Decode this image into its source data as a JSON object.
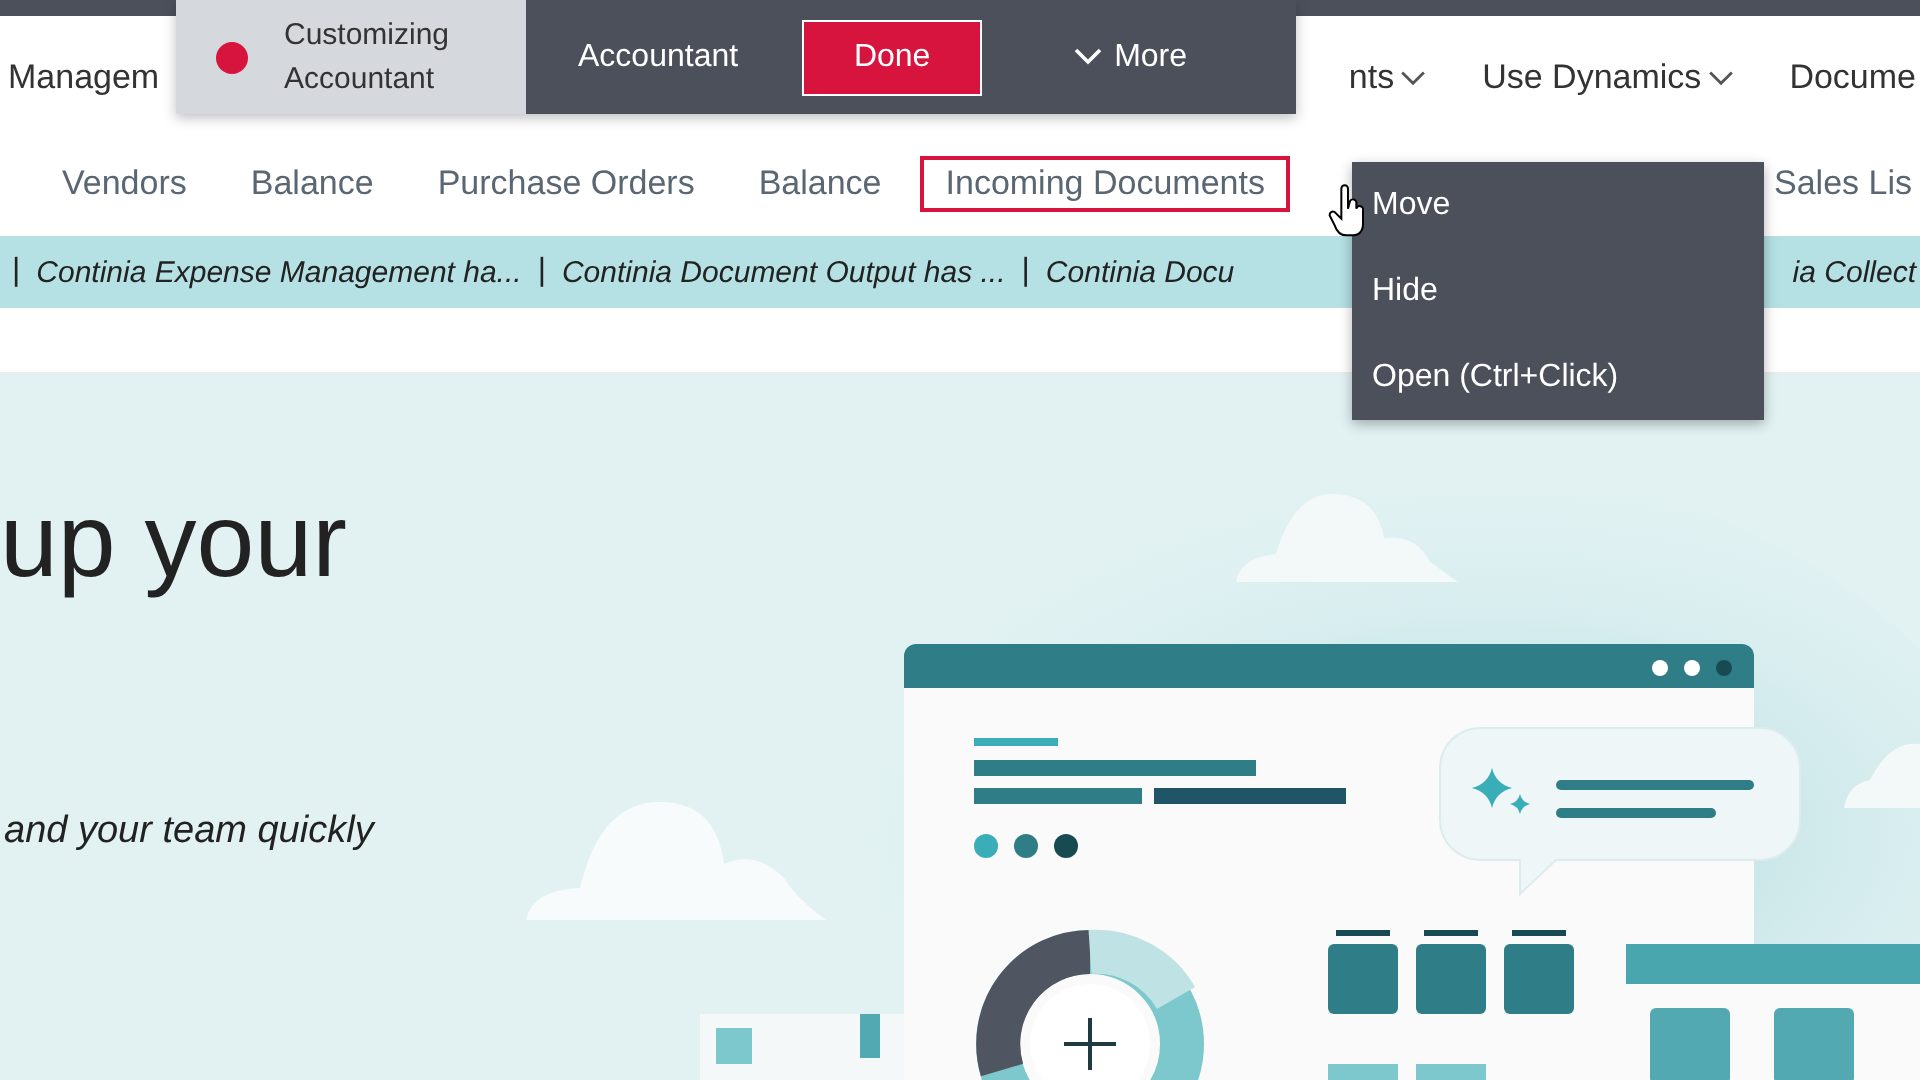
{
  "header_nav": {
    "items": [
      {
        "label": "Managem",
        "dropdown": false
      },
      {
        "label": "nts",
        "dropdown": true
      },
      {
        "label": "Use Dynamics",
        "dropdown": true
      },
      {
        "label": "Docume",
        "dropdown": false
      }
    ]
  },
  "customize_bar": {
    "title": "Customizing",
    "subtitle": "Accountant",
    "profile": "Accountant",
    "done_button": "Done",
    "more_button": "More"
  },
  "subnav": {
    "items": [
      {
        "label": "Vendors",
        "selected": false
      },
      {
        "label": "Balance",
        "selected": false
      },
      {
        "label": "Purchase Orders",
        "selected": false
      },
      {
        "label": "Balance",
        "selected": false
      },
      {
        "label": "Incoming Documents",
        "selected": true
      },
      {
        "label": "Sales Lis",
        "selected": false
      }
    ]
  },
  "notification_bar": {
    "items": [
      {
        "kind": "separator",
        "text": "|"
      },
      {
        "kind": "link",
        "text": "Continia Expense Management ha..."
      },
      {
        "kind": "separator",
        "text": "|"
      },
      {
        "kind": "link",
        "text": "Continia Document Output has ..."
      },
      {
        "kind": "separator",
        "text": "|"
      },
      {
        "kind": "link",
        "text": "Continia Docu"
      },
      {
        "kind": "link",
        "text": "ia Collect"
      }
    ]
  },
  "context_menu": {
    "items": [
      "Move",
      "Hide",
      "Open (Ctrl+Click)"
    ]
  },
  "hero": {
    "heading": "up your",
    "subtitle": "and your team quickly"
  }
}
